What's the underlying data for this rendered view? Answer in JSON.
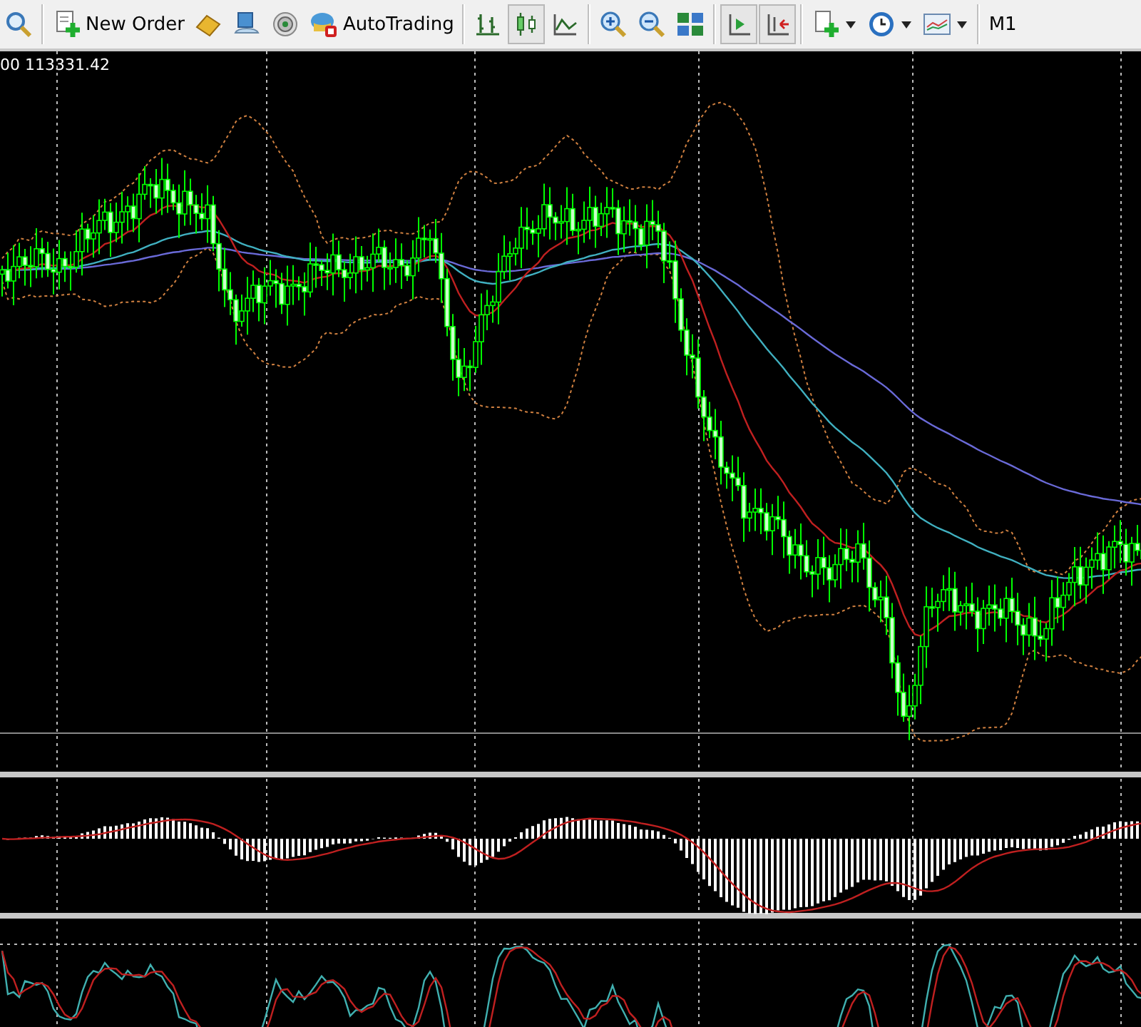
{
  "toolbar": {
    "new_order": {
      "label": "New Order"
    },
    "autotrading": {
      "label": "AutoTrading"
    },
    "chart_types": [
      {
        "selected": false
      },
      {
        "selected": true
      },
      {
        "selected": false
      }
    ],
    "autoscroll": {
      "pressed": true
    },
    "chart_shift": {
      "pressed": true
    },
    "timeframe": {
      "label": "M1"
    }
  },
  "chart": {
    "header": "00 113331.42"
  }
}
